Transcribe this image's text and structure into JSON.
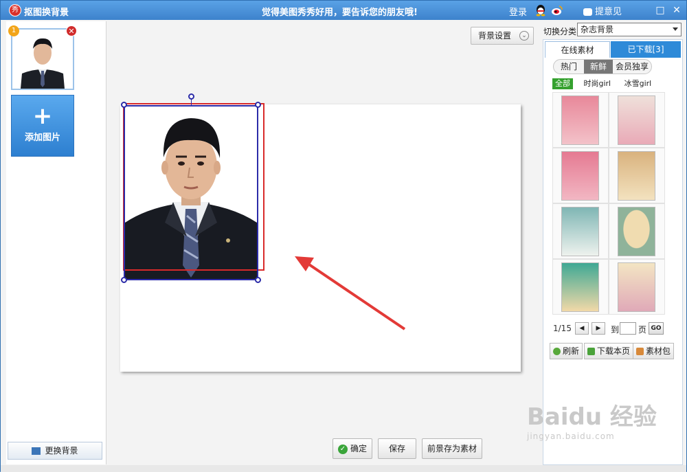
{
  "titlebar": {
    "logo_char": "秀",
    "title": "抠图换背景",
    "slogan": "觉得美图秀秀好用，要告诉您的朋友哦!",
    "login": "登录",
    "feedback": "提意见",
    "max_icon": "□",
    "close_icon": "✕"
  },
  "left_panel": {
    "thumb_index": "1",
    "thumb_close": "✕",
    "add_plus": "+",
    "add_label": "添加图片",
    "change_bg_label": "更换背景"
  },
  "canvas_area": {
    "bg_settings_label": "背景设置",
    "bg_settings_chevron": "⌄",
    "confirm_check": "✓",
    "confirm_label": "确定",
    "save_label": "保存",
    "save_as_material_label": "前景存为素材"
  },
  "right_panel": {
    "category_label": "切换分类",
    "category_value": "杂志背景",
    "tabs": [
      {
        "label": "在线素材"
      },
      {
        "label": "已下载[3]"
      }
    ],
    "subtabs": [
      {
        "label": "热门"
      },
      {
        "label": "新鲜"
      },
      {
        "label": "会员独享"
      }
    ],
    "filters": [
      {
        "label": "全部"
      },
      {
        "label": "时尚girl"
      },
      {
        "label": "冰雪girl"
      }
    ],
    "pager": {
      "page_text": "1/15",
      "prev_icon": "◀",
      "next_icon": "▶",
      "to_label": "到",
      "page_input_value": "",
      "page_unit": "页",
      "go_label": "GO"
    },
    "actions": [
      {
        "label": "刷新"
      },
      {
        "label": "下载本页"
      },
      {
        "label": "素材包"
      }
    ]
  },
  "watermark": {
    "brand": "Bai⁠du 经验",
    "url": "jingyan.baidu.com"
  },
  "colors": {
    "titlebar": "#3d82cc",
    "accent_blue": "#2e8ad8",
    "selection_red": "#d92a2a",
    "selection_blue": "#2b2ba8",
    "filter_green": "#35a12f"
  }
}
